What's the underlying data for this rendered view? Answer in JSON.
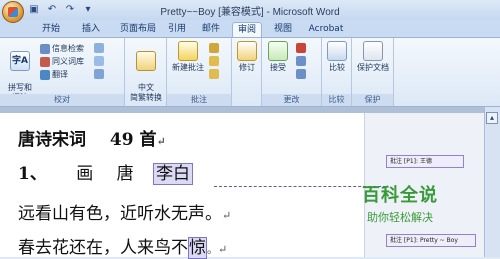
{
  "window": {
    "title": "Pretty~~Boy [兼容模式] - Microsoft Word"
  },
  "tabs": [
    "开始",
    "插入",
    "页面布局",
    "引用",
    "邮件",
    "审阅",
    "视图",
    "Acrobat"
  ],
  "active_tab": "审阅",
  "ribbon": {
    "proofing": {
      "label": "校对",
      "spelling": "拼写和\n语法",
      "research": "信息检索",
      "thesaurus": "同义词库",
      "translate": "翻译"
    },
    "chinese": {
      "label": "中文简繁转换",
      "button": "中文\n简繁转换"
    },
    "comments": {
      "label": "批注",
      "new_comment": "新建批注"
    },
    "tracking": {
      "label": "修订",
      "track": "修订"
    },
    "changes": {
      "label": "更改",
      "accept": "接受"
    },
    "compare": {
      "label": "比较",
      "compare": "比较"
    },
    "protect": {
      "label": "保护",
      "protect_doc": "保护文档"
    }
  },
  "document": {
    "line1_title": "唐诗宋词",
    "line1_count": "49 首",
    "line2_num": "1、",
    "line2_a": "画",
    "line2_b": "唐",
    "line2_author": "李白",
    "line3": "远看山有色，近听水无声。",
    "line4_a": "春去花还在，人来鸟不",
    "line4_hl": "惊"
  },
  "comments": {
    "c1": "批注 [P1]: 王德",
    "c2": "批注 [P1]: Pretty ~ Boy"
  },
  "watermark": {
    "main": "百科全说",
    "sub": "助你轻松解决"
  }
}
